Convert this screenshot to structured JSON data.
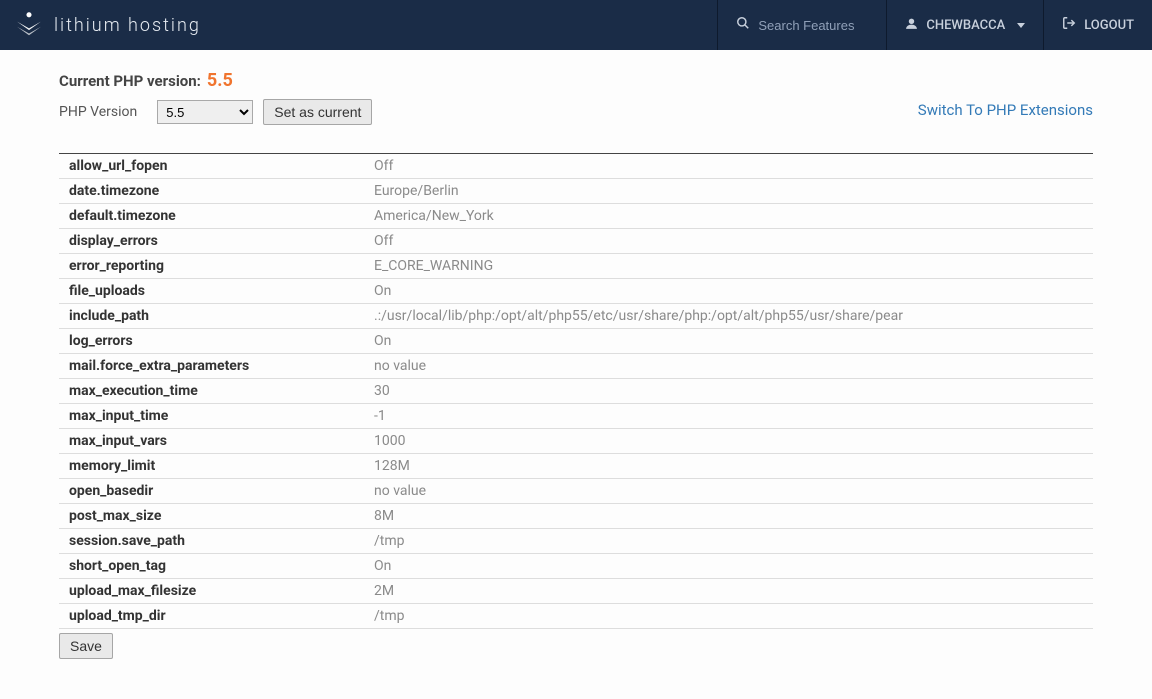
{
  "brand": "lithium hosting",
  "search": {
    "placeholder": "Search Features"
  },
  "user": {
    "name": "CHEWBACCA"
  },
  "logout": "LOGOUT",
  "current_label": "Current PHP version:",
  "current_version": "5.5",
  "version_label": "PHP Version",
  "version_select": "5.5",
  "set_current_btn": "Set as current",
  "switch_link": "Switch To PHP Extensions",
  "save_btn": "Save",
  "settings": [
    {
      "k": "allow_url_fopen",
      "v": "Off"
    },
    {
      "k": "date.timezone",
      "v": "Europe/Berlin"
    },
    {
      "k": "default.timezone",
      "v": "America/New_York"
    },
    {
      "k": "display_errors",
      "v": "Off"
    },
    {
      "k": "error_reporting",
      "v": "E_CORE_WARNING"
    },
    {
      "k": "file_uploads",
      "v": "On"
    },
    {
      "k": "include_path",
      "v": ".:/usr/local/lib/php:/opt/alt/php55/etc/usr/share/php:/opt/alt/php55/usr/share/pear"
    },
    {
      "k": "log_errors",
      "v": "On"
    },
    {
      "k": "mail.force_extra_parameters",
      "v": "no value"
    },
    {
      "k": "max_execution_time",
      "v": "30"
    },
    {
      "k": "max_input_time",
      "v": "-1"
    },
    {
      "k": "max_input_vars",
      "v": "1000"
    },
    {
      "k": "memory_limit",
      "v": "128M"
    },
    {
      "k": "open_basedir",
      "v": "no value"
    },
    {
      "k": "post_max_size",
      "v": "8M"
    },
    {
      "k": "session.save_path",
      "v": "/tmp"
    },
    {
      "k": "short_open_tag",
      "v": "On"
    },
    {
      "k": "upload_max_filesize",
      "v": "2M"
    },
    {
      "k": "upload_tmp_dir",
      "v": "/tmp"
    }
  ]
}
